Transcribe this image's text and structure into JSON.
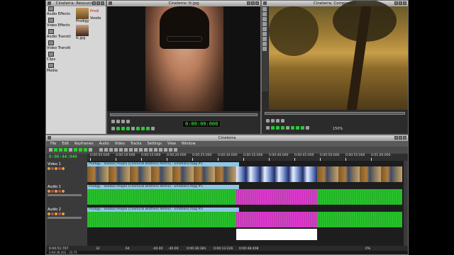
{
  "resources": {
    "title": "Cinelerra: Resources",
    "folders": [
      "Audio Effects",
      "Video Effects",
      "Audio Transiti",
      "Video Transiti",
      "Clips",
      "Media"
    ],
    "assets": [
      {
        "label": "Prodigy",
        "selected": false
      },
      {
        "label": "Voodo",
        "selected": false
      },
      {
        "label": "tt.jpg",
        "selected": true
      }
    ],
    "red_label": "Prodi"
  },
  "viewer": {
    "title": "Cinelerra: tt.jpg",
    "timecode": "0:00:00:000"
  },
  "compositor": {
    "title": "Cinelerra: Compositor",
    "zoom": "150%"
  },
  "timeline": {
    "title": "Cinelerra",
    "menu": [
      "File",
      "Edit",
      "Keyframes",
      "Audio",
      "Video",
      "Tracks",
      "Settings",
      "View",
      "Window"
    ],
    "timecode": "0:00:44:940",
    "ruler_ticks": [
      "0:00:05:000",
      "0:00:10:000",
      "0:00:15:000",
      "0:00:20:000",
      "0:00:25:000",
      "0:00:30:000",
      "0:00:35:000",
      "0:00:40:000",
      "0:00:45:000",
      "0:00:50:000",
      "0:00:55:000",
      "0:01:00:000"
    ],
    "tracks": [
      {
        "name": "Video 1",
        "clip_title": "Prodigy - Voodoo People (Chemical Brothers Remix) - Emotions.mpg #1"
      },
      {
        "name": "Audio 1",
        "clip_title": "Prodigy - Voodoo People (Chemical Brothers Remix) - Emotions.mpg #1"
      },
      {
        "name": "Audio 2",
        "clip_title": "Prodigy - Voodoo People (Chemical Brothers Remix) - Emotions.mpg #2"
      }
    ],
    "status": {
      "pos": "0:00:51:707",
      "sample": "32",
      "zoom": "64",
      "db": "-40.00",
      "db2": "-40.00",
      "sel_start": "0:00:36:381",
      "len": "0:00:13:226",
      "sel_end": "0:00:48:408",
      "bottom_left": "0:00:36:201 - 23.75",
      "pct": "0%"
    }
  }
}
